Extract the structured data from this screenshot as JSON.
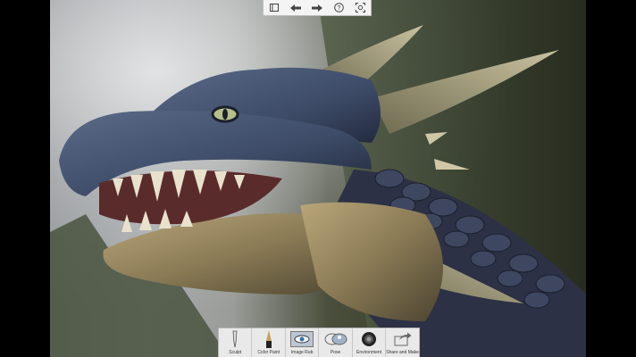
{
  "top_toolbar": {
    "buttons": [
      {
        "name": "menu",
        "icon": "panel-icon"
      },
      {
        "name": "undo",
        "icon": "arrow-left-icon"
      },
      {
        "name": "redo",
        "icon": "arrow-right-icon"
      },
      {
        "name": "help",
        "icon": "help-icon",
        "glyph": "?"
      },
      {
        "name": "screenshot",
        "icon": "camera-frame-icon"
      }
    ]
  },
  "bottom_toolbar": {
    "tools": [
      {
        "label": "Sculpt",
        "icon": "sculpt-brush-icon"
      },
      {
        "label": "Color Paint",
        "icon": "paint-brush-icon"
      },
      {
        "label": "Image Rub",
        "icon": "eye-image-icon"
      },
      {
        "label": "Pose",
        "icon": "pose-figure-icon"
      },
      {
        "label": "Environment",
        "icon": "environment-sphere-icon"
      },
      {
        "label": "Share and Make",
        "icon": "share-arrow-icon"
      }
    ]
  },
  "colors": {
    "toolbar_bg": "#e9e9e9",
    "dragon_skin": "#8a7a55",
    "dragon_head": "#3c4a66",
    "sky_fog": "#c9cbcc",
    "cliff": "#3a3f2c"
  }
}
